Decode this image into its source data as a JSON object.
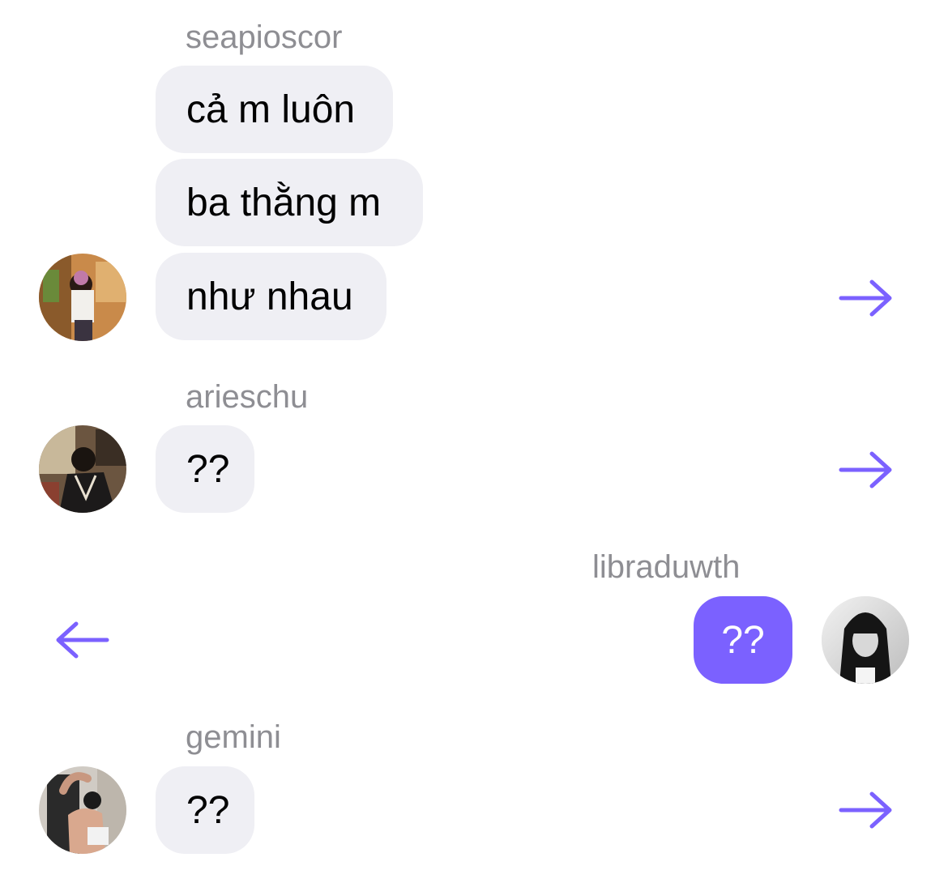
{
  "colors": {
    "accent": "#7b61ff",
    "bubble_gray": "#efeff4",
    "name_gray": "#8e8e93"
  },
  "groups": [
    {
      "sender": "seapioscor",
      "avatar": "avatar-photo-icon",
      "messages": [
        "cả m luôn",
        "ba thằng m",
        "như nhau"
      ],
      "action": "forward-arrow-icon"
    },
    {
      "sender": "arieschu",
      "avatar": "avatar-photo-icon",
      "messages": [
        "??"
      ],
      "action": "forward-arrow-icon"
    },
    {
      "sender": "libraduwth",
      "avatar": "avatar-photo-icon",
      "messages": [
        "??"
      ],
      "action": "back-arrow-icon",
      "outgoing": true
    },
    {
      "sender": "gemini",
      "avatar": "avatar-photo-icon",
      "messages": [
        "??"
      ],
      "action": "forward-arrow-icon"
    }
  ]
}
